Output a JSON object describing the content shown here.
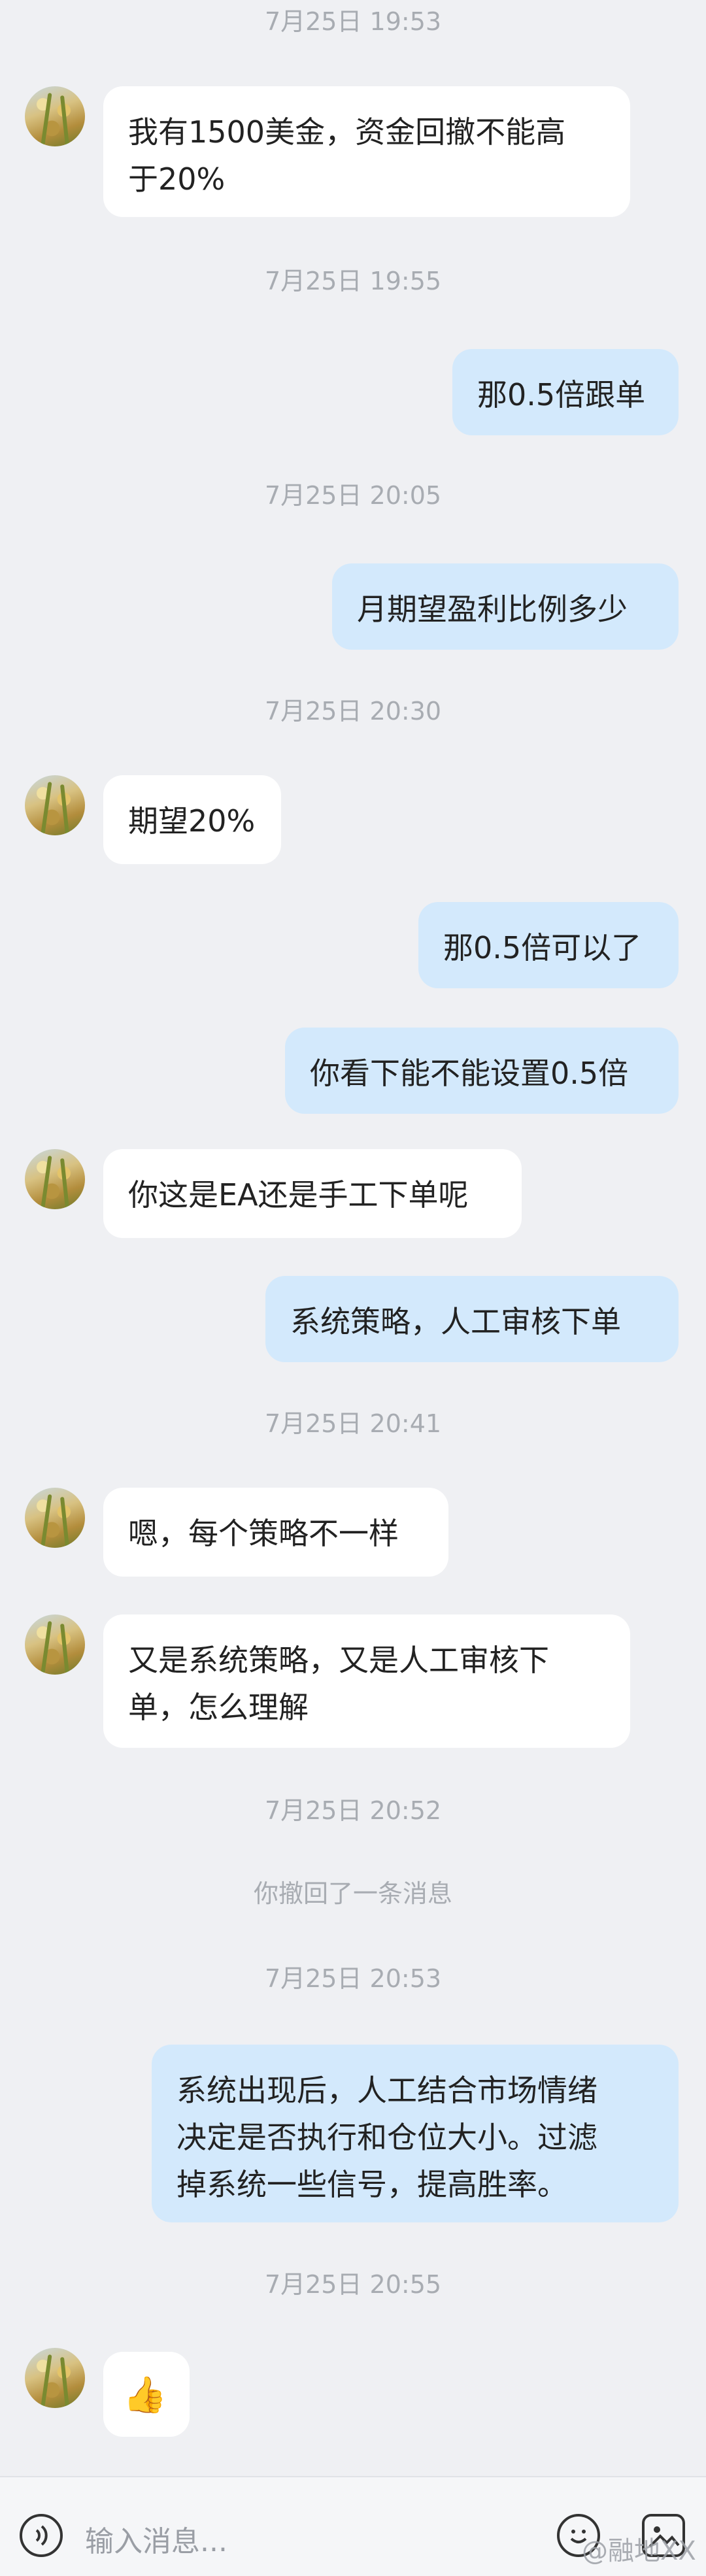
{
  "messages": [
    {
      "type": "time",
      "text": "7月25日 19:53"
    },
    {
      "type": "in",
      "text": "我有1500美金，资金回撤不能高\n于20%"
    },
    {
      "type": "time",
      "text": "7月25日 19:55"
    },
    {
      "type": "out",
      "text": "那0.5倍跟单"
    },
    {
      "type": "time",
      "text": "7月25日 20:05"
    },
    {
      "type": "out",
      "text": "月期望盈利比例多少"
    },
    {
      "type": "time",
      "text": "7月25日 20:30"
    },
    {
      "type": "in",
      "text": "期望20%"
    },
    {
      "type": "out",
      "text": "那0.5倍可以了"
    },
    {
      "type": "out",
      "text": "你看下能不能设置0.5倍"
    },
    {
      "type": "in",
      "text": "你这是EA还是手工下单呢"
    },
    {
      "type": "out",
      "text": "系统策略，人工审核下单"
    },
    {
      "type": "time",
      "text": "7月25日 20:41"
    },
    {
      "type": "in",
      "text": "嗯，每个策略不一样"
    },
    {
      "type": "in",
      "text": "又是系统策略，又是人工审核下\n单，怎么理解"
    },
    {
      "type": "time",
      "text": "7月25日 20:52"
    },
    {
      "type": "system",
      "text": "你撤回了一条消息"
    },
    {
      "type": "time",
      "text": "7月25日 20:53"
    },
    {
      "type": "out",
      "text": "系统出现后，人工结合市场情绪\n决定是否执行和仓位大小。过滤\n掉系统一些信号，提高胜率。"
    },
    {
      "type": "time",
      "text": "7月25日 20:55"
    },
    {
      "type": "in",
      "text": "👍"
    }
  ],
  "input": {
    "placeholder": "输入消息..."
  },
  "icons": {
    "voice": "voice-icon",
    "emoji": "emoji-icon",
    "more": "image-icon"
  },
  "watermark": "@融地XX",
  "colors": {
    "background": "#eff0f3",
    "incoming": "#ffffff",
    "outgoing": "#d3e9fc",
    "timestamp": "#a8acb2"
  }
}
